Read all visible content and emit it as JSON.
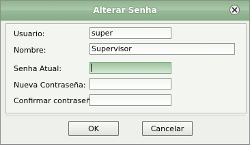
{
  "window": {
    "title": "Alterar Senha"
  },
  "form": {
    "usuario_label": "Usuario:",
    "usuario_value": "super",
    "nombre_label": "Nombre:",
    "nombre_value": "Supervisor",
    "senha_atual_label": "Senha Atual:",
    "senha_atual_value": "",
    "nueva_label": "Nueva Contraseña:",
    "nueva_value": "",
    "confirmar_label": "Confirmar contraseña:",
    "confirmar_value": ""
  },
  "buttons": {
    "ok_label": "OK",
    "cancel_label": "Cancelar"
  },
  "icons": {
    "close": "close-icon"
  },
  "colors": {
    "titlebar": "#98b998",
    "focus": "#9fc49f"
  }
}
